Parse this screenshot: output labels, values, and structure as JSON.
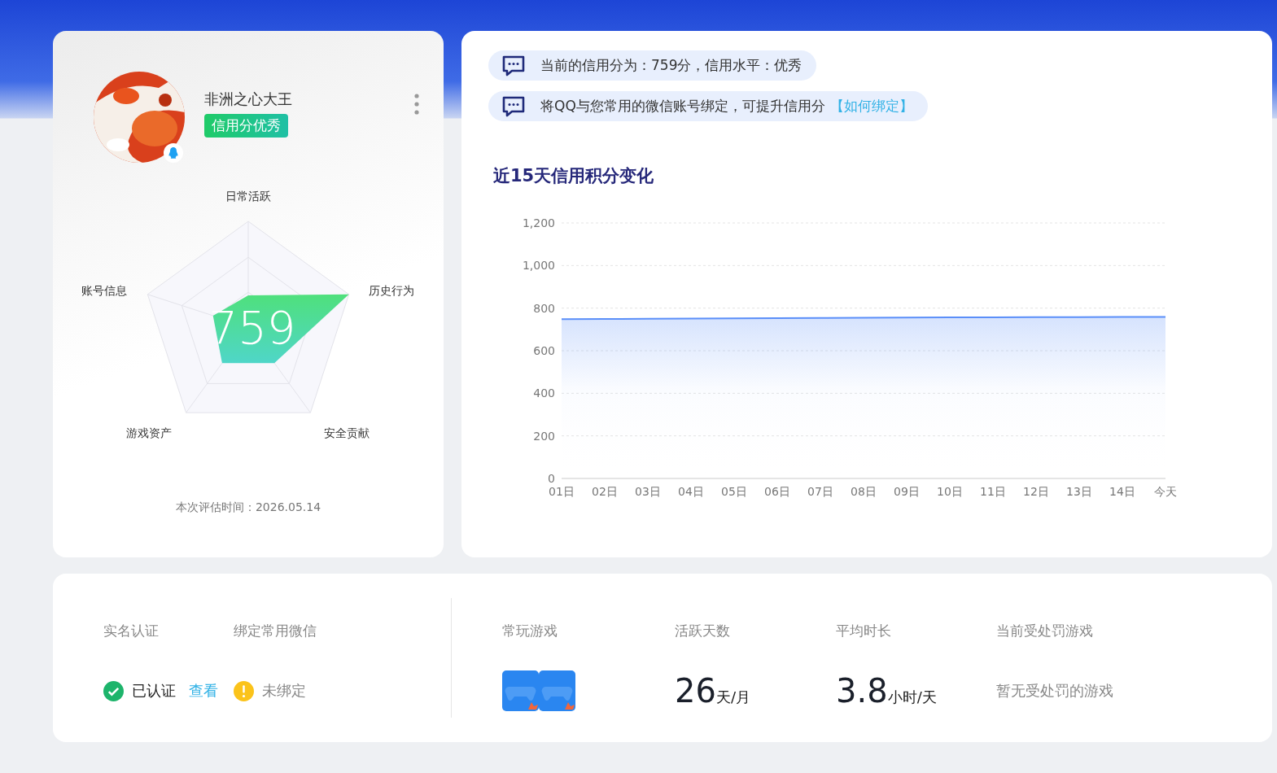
{
  "profile": {
    "name": "非洲之心大王",
    "badge": "信用分优秀"
  },
  "radar": {
    "axes": [
      "日常活跃",
      "历史行为",
      "安全贡献",
      "游戏资产",
      "账号信息"
    ],
    "score": "759"
  },
  "evaluation_time": "本次评估时间：2026.05.14",
  "messages": [
    {
      "text": "当前的信用分为：759分，信用水平：优秀"
    },
    {
      "text": "将QQ与您常用的微信账号绑定，可提升信用分",
      "link": "【如何绑定】"
    }
  ],
  "chart_panel": {
    "title": "近15天信用积分变化",
    "chart_data": {
      "type": "area",
      "categories": [
        "01日",
        "02日",
        "03日",
        "04日",
        "05日",
        "06日",
        "07日",
        "08日",
        "09日",
        "10日",
        "11日",
        "12日",
        "13日",
        "14日",
        "今天"
      ],
      "grid": true,
      "series": [
        {
          "color": "#5b8ff9",
          "values": [
            748,
            749,
            750,
            751,
            752,
            753,
            754,
            755,
            756,
            757,
            757,
            758,
            758,
            759,
            759
          ]
        }
      ],
      "ylim": [
        0,
        1200
      ],
      "yticks": [
        {
          "value": 0,
          "label": "0"
        },
        {
          "value": 200,
          "label": "200"
        },
        {
          "value": 400,
          "label": "400"
        },
        {
          "value": 600,
          "label": "600"
        },
        {
          "value": 800,
          "label": "800"
        },
        {
          "value": 1000,
          "label": "1,000"
        },
        {
          "value": 1200,
          "label": "1,200"
        }
      ]
    }
  },
  "summary": {
    "account": [
      {
        "label": "实名认证",
        "status": "已认证",
        "kind": "ok",
        "link": "查看"
      },
      {
        "label": "绑定常用微信",
        "status": "未绑定",
        "kind": "warn"
      }
    ],
    "stats": [
      {
        "kind": "games",
        "label": "常玩游戏"
      },
      {
        "kind": "stat",
        "label": "活跃天数",
        "value": "26",
        "unit": "天/月"
      },
      {
        "kind": "stat",
        "label": "平均时长",
        "value": "3.8",
        "unit": "小时/天"
      },
      {
        "kind": "text",
        "label": "当前受处罚游戏",
        "text": "暂无受处罚的游戏"
      }
    ]
  }
}
